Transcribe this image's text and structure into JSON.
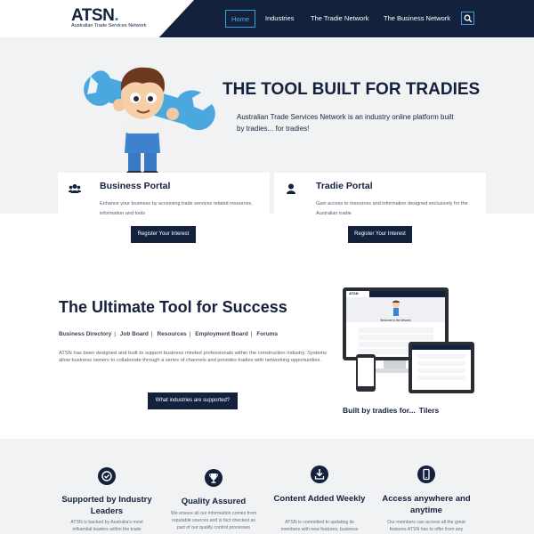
{
  "header": {
    "logo": "ATSN",
    "logo_dot": ".",
    "logo_sub": "Australian Trade Services Network",
    "nav": [
      "Home",
      "Industries",
      "The Tradie Network",
      "The Business Network"
    ],
    "search_icon": "search-icon"
  },
  "hero": {
    "title": "THE TOOL BUILT FOR TRADIES",
    "description": "Australian Trade Services Network is an industry online platform built by tradies... for tradies!"
  },
  "cards": [
    {
      "title": "Business Portal",
      "description": "Enhance your business by accessing trade services related resources, information and tools",
      "icon": "users-icon",
      "button": "Register Your Interest"
    },
    {
      "title": "Tradie Portal",
      "description": "Gain access to resources and information designed exclusively for the Australian tradie",
      "icon": "user-icon",
      "button": "Register Your Interest"
    }
  ],
  "success": {
    "title": "The Ultimate Tool for Success",
    "links": [
      "Business Directory",
      "Job Board",
      "Resources",
      "Employment Board",
      "Forums"
    ],
    "description": "ATSN has been designed and built to support business minded professionals within the construction industry. Systems allow business owners to collaborate through a series of channels and provides tradies with networking opportunities.",
    "button": "What industries are supported?",
    "built_by": "Built by tradies for...",
    "built_role": "Tilers"
  },
  "device_screen": {
    "logo": "ATSN",
    "welcome": "Welcome to the Network"
  },
  "features": [
    {
      "title": "Supported by Industry Leaders",
      "description": "ATSN is backed by Australia's most influential leaders within the trade",
      "icon": "check-icon"
    },
    {
      "title": "Quality Assured",
      "description": "We ensure all our information comes from reputable sources and is fact checked as part of our quality control processes",
      "icon": "trophy-icon"
    },
    {
      "title": "Content Added Weekly",
      "description": "ATSN is committed to updating its members with new features, business",
      "icon": "download-icon"
    },
    {
      "title": "Access anywhere and anytime",
      "description": "Our members can access all the great features ATSN has to offer from any",
      "icon": "mobile-icon"
    }
  ],
  "colors": {
    "navy": "#14213d",
    "accent": "#3aa0d8",
    "light_bg": "#f1f2f4"
  }
}
